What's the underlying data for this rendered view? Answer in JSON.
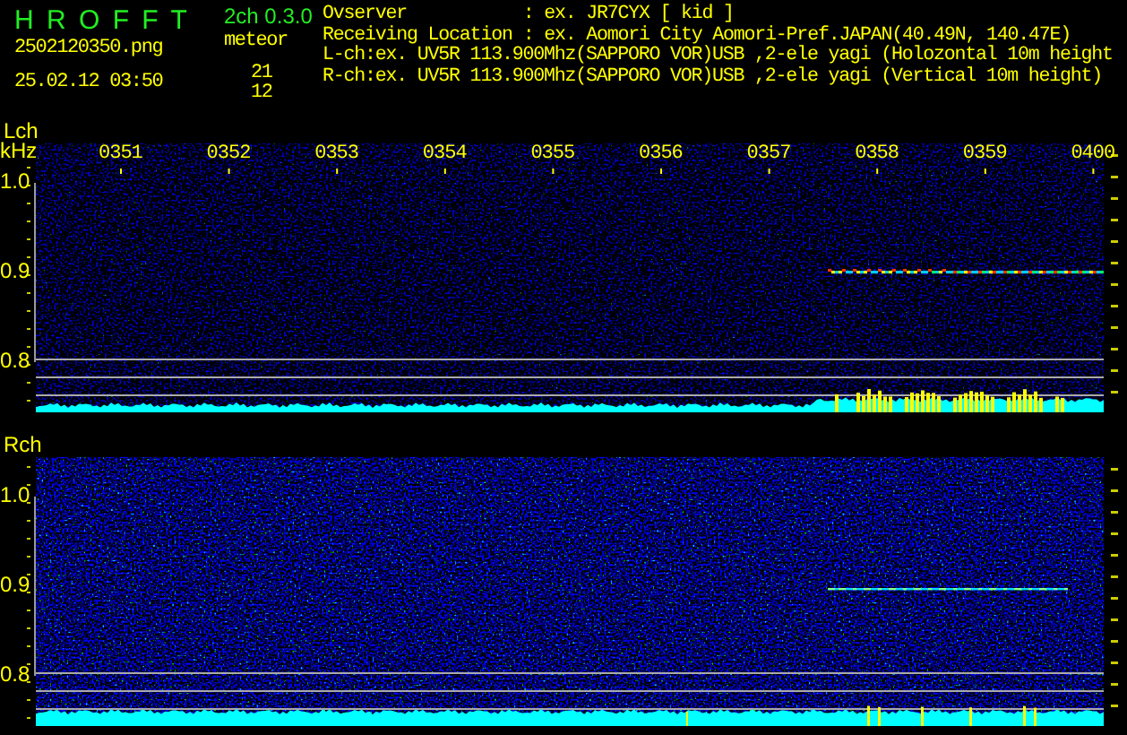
{
  "app": {
    "title": "H R O F F T",
    "version": "2ch 0.3.0"
  },
  "file": {
    "name": "2502120350.png",
    "datetime": "25.02.12 03:50"
  },
  "meteor": {
    "label": "meteor",
    "counts": [
      "21",
      "12"
    ]
  },
  "info": [
    {
      "label": "Ovserver",
      "value": ": ex. JR7CYX [ kid ]"
    },
    {
      "label": "Receiving Location",
      "value": ": ex. Aomori City Aomori-Pref.JAPAN(40.49N, 140.47E)"
    }
  ],
  "channel_lines": [
    "L-ch:ex. UV5R 113.900Mhz(SAPPORO VOR)USB ,2-ele yagi (Holozontal 10m height",
    "R-ch:ex. UV5R 113.900Mhz(SAPPORO VOR)USB ,2-ele yagi (Vertical 10m height)"
  ],
  "panels": [
    {
      "channel": "Lch",
      "unit": "kHz",
      "time_labels": [
        "0351",
        "0352",
        "0353",
        "0354",
        "0355",
        "0356",
        "0357",
        "0358",
        "0359",
        "0400"
      ],
      "yticks": [
        "1.0",
        "0.9",
        "0.8"
      ]
    },
    {
      "channel": "Rch",
      "yticks": [
        "1.0",
        "0.9",
        "0.8"
      ]
    }
  ]
}
